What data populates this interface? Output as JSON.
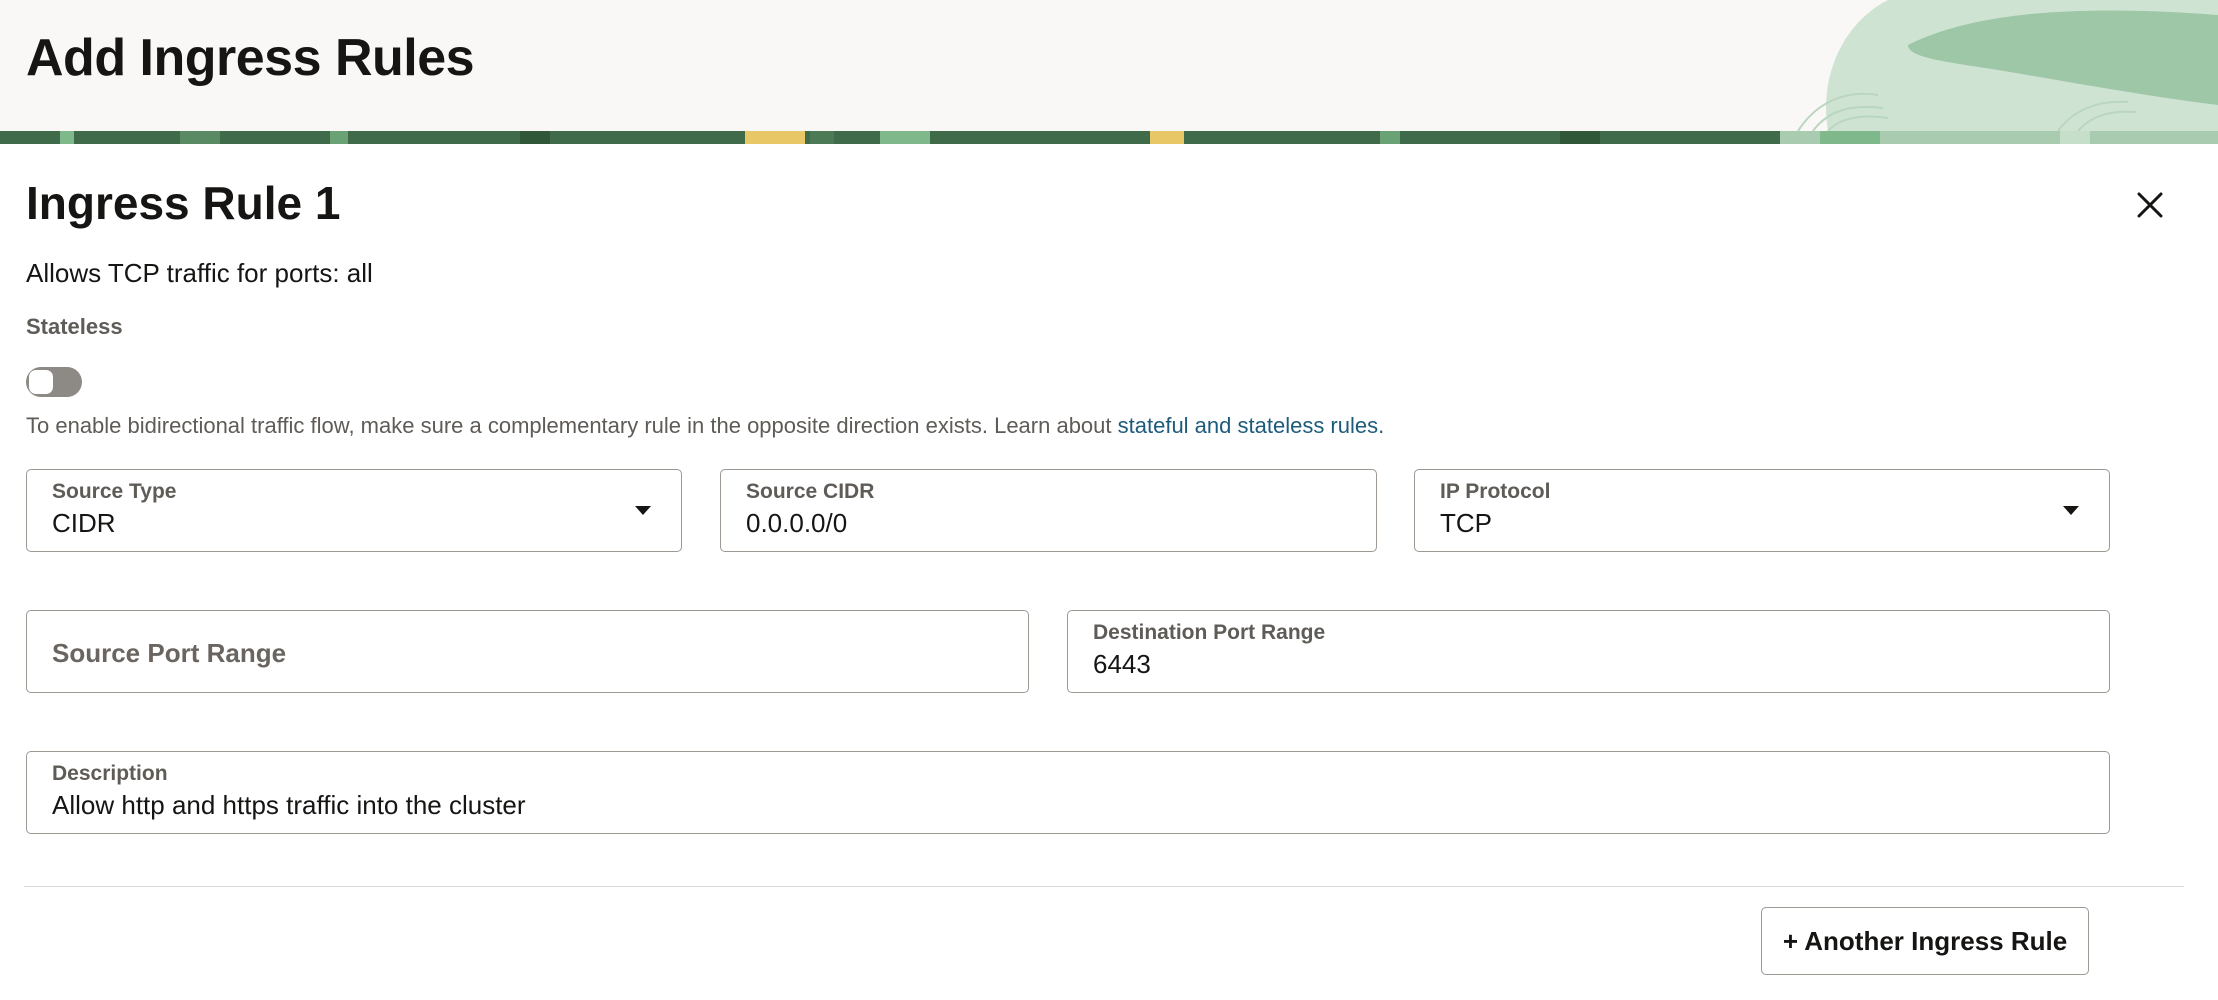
{
  "header": {
    "title": "Add Ingress Rules"
  },
  "rule": {
    "title": "Ingress Rule 1",
    "summary": "Allows TCP traffic for ports: all",
    "stateless": {
      "label": "Stateless",
      "enabled": false
    },
    "hint": {
      "text": "To enable bidirectional traffic flow, make sure a complementary rule in the opposite direction exists. Learn about ",
      "link": "stateful and stateless rules."
    },
    "fields": {
      "source_type": {
        "label": "Source Type",
        "value": "CIDR"
      },
      "source_cidr": {
        "label": "Source CIDR",
        "value": "0.0.0.0/0"
      },
      "ip_protocol": {
        "label": "IP Protocol",
        "value": "TCP"
      },
      "source_port_range": {
        "placeholder": "Source Port Range",
        "value": ""
      },
      "destination_port_range": {
        "label": "Destination Port Range",
        "value": "6443"
      },
      "description": {
        "label": "Description",
        "value": "Allow http and https traffic into the cluster"
      }
    }
  },
  "actions": {
    "add_rule": "+ Another Ingress Rule"
  },
  "icons": {
    "close": "close-icon",
    "dropdown": "chevron-down-icon"
  },
  "colors": {
    "link": "#1d5b7b",
    "text": "#161513",
    "muted": "#5f5b57",
    "header_bg": "#f9f8f6",
    "toggle_off": "#8d8985",
    "border": "#9e9892"
  }
}
